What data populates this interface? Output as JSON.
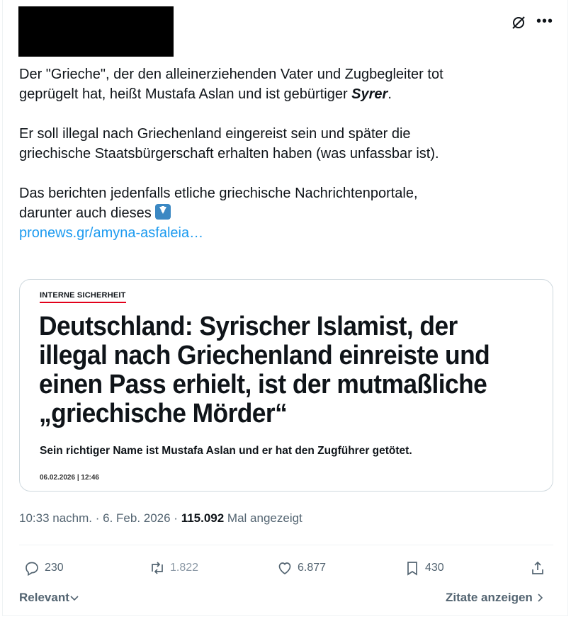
{
  "post": {
    "redacted_author": "",
    "text_line1": "Der \"Grieche\", der den alleinerziehenden Vater und Zugbegleiter tot",
    "text_line2_a": "geprügelt hat, heißt Mustafa Aslan und ist gebürtiger ",
    "text_line2_bold": "Syrer",
    "text_line2_b": ".",
    "text_para2_line1": "Er soll illegal nach Griechenland eingereist sein und später die",
    "text_para2_line2": "griechische Staatsbürgerschaft erhalten haben (was unfassbar ist).",
    "text_para3_line1": "Das berichten jedenfalls etliche griechische Nachrichtenportale,",
    "text_para3_line2": "darunter auch dieses ",
    "link": "pronews.gr/amyna-asfaleia…"
  },
  "card": {
    "kicker": "INTERNE SICHERHEIT",
    "headline_line1": "Deutschland: Syrischer Islamist, der",
    "headline_line2": "illegal nach Griechenland einreiste und",
    "headline_line3": "einen Pass erhielt, ist der mutmaßliche",
    "headline_line4": "„griechische Mörder“",
    "subline": "Sein richtiger Name ist Mustafa Aslan und er hat den Zugführer getötet.",
    "date": "06.02.2026 | 12:46"
  },
  "meta": {
    "time": "10:33 nachm. · 6. Feb. 2026 · ",
    "views": "115.092",
    "views_label": " Mal angezeigt"
  },
  "actions": {
    "replies": "230",
    "reposts": "1.822",
    "likes": "6.877",
    "bookmarks": "430"
  },
  "footer": {
    "relevant": "Relevant",
    "quotes": "Zitate anzeigen"
  },
  "icons": [
    "grok-icon",
    "more-icon",
    "arrow-down-emoji",
    "reply-icon",
    "repost-icon",
    "like-icon",
    "bookmark-icon",
    "share-icon",
    "chevron-down-icon",
    "chevron-right-icon"
  ],
  "colors": {
    "link": "#1d9bf0",
    "muted": "#536471",
    "kicker_underline": "#e2001a",
    "emoji_bg": "#3b88c3"
  }
}
